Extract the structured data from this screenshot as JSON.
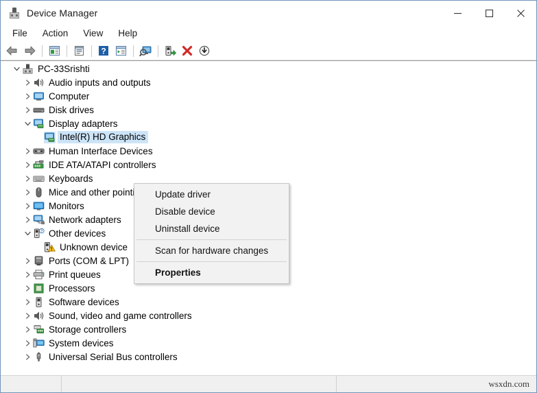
{
  "window": {
    "title": "Device Manager",
    "icon": "device-manager-icon",
    "controls": {
      "minimize": "minimize-icon",
      "maximize": "maximize-icon",
      "close": "close-icon"
    }
  },
  "menubar": {
    "items": [
      {
        "label": "File"
      },
      {
        "label": "Action"
      },
      {
        "label": "View"
      },
      {
        "label": "Help"
      }
    ]
  },
  "toolbar": {
    "buttons": [
      {
        "name": "back-button",
        "icon": "back-arrow-icon"
      },
      {
        "name": "forward-button",
        "icon": "forward-arrow-icon"
      },
      {
        "name": "separator",
        "icon": "separator"
      },
      {
        "name": "show-hide-console-tree-button",
        "icon": "console-tree-icon"
      },
      {
        "name": "separator",
        "icon": "separator"
      },
      {
        "name": "properties-button",
        "icon": "properties-window-icon"
      },
      {
        "name": "separator",
        "icon": "separator"
      },
      {
        "name": "help-button",
        "icon": "help-question-icon"
      },
      {
        "name": "view-button",
        "icon": "view-list-icon"
      },
      {
        "name": "separator",
        "icon": "separator"
      },
      {
        "name": "scan-hardware-changes-button",
        "icon": "scan-monitor-icon"
      },
      {
        "name": "separator",
        "icon": "separator"
      },
      {
        "name": "update-driver-button",
        "icon": "update-driver-icon"
      },
      {
        "name": "uninstall-device-button",
        "icon": "red-x-icon"
      },
      {
        "name": "disable-device-button",
        "icon": "down-arrow-circle-icon"
      }
    ]
  },
  "tree": {
    "nodes": [
      {
        "label": "PC-33Srishti",
        "icon": "computer-root-icon",
        "indent": 0,
        "state": "expanded",
        "selected": false
      },
      {
        "label": "Audio inputs and outputs",
        "icon": "speaker-icon",
        "indent": 1,
        "state": "collapsed",
        "selected": false
      },
      {
        "label": "Computer",
        "icon": "monitor-icon",
        "indent": 1,
        "state": "collapsed",
        "selected": false
      },
      {
        "label": "Disk drives",
        "icon": "disk-drive-icon",
        "indent": 1,
        "state": "collapsed",
        "selected": false
      },
      {
        "label": "Display adapters",
        "icon": "display-adapter-icon",
        "indent": 1,
        "state": "expanded",
        "selected": false
      },
      {
        "label": "Intel(R) HD Graphics",
        "icon": "display-adapter-icon",
        "indent": 2,
        "state": "leaf",
        "selected": true
      },
      {
        "label": "Human Interface Devices",
        "icon": "hid-icon",
        "indent": 1,
        "state": "collapsed",
        "selected": false
      },
      {
        "label": "IDE ATA/ATAPI controllers",
        "icon": "ide-controller-icon",
        "indent": 1,
        "state": "collapsed",
        "selected": false
      },
      {
        "label": "Keyboards",
        "icon": "keyboard-icon",
        "indent": 1,
        "state": "collapsed",
        "selected": false
      },
      {
        "label": "Mice and other pointing devices",
        "icon": "mouse-icon",
        "indent": 1,
        "state": "collapsed",
        "selected": false
      },
      {
        "label": "Monitors",
        "icon": "monitor-icon",
        "indent": 1,
        "state": "collapsed",
        "selected": false
      },
      {
        "label": "Network adapters",
        "icon": "network-adapter-icon",
        "indent": 1,
        "state": "collapsed",
        "selected": false
      },
      {
        "label": "Other devices",
        "icon": "other-device-icon",
        "indent": 1,
        "state": "expanded",
        "selected": false
      },
      {
        "label": "Unknown device",
        "icon": "unknown-device-warning-icon",
        "indent": 2,
        "state": "leaf",
        "selected": false
      },
      {
        "label": "Ports (COM & LPT)",
        "icon": "port-icon",
        "indent": 1,
        "state": "collapsed",
        "selected": false
      },
      {
        "label": "Print queues",
        "icon": "printer-icon",
        "indent": 1,
        "state": "collapsed",
        "selected": false
      },
      {
        "label": "Processors",
        "icon": "processor-icon",
        "indent": 1,
        "state": "collapsed",
        "selected": false
      },
      {
        "label": "Software devices",
        "icon": "software-device-icon",
        "indent": 1,
        "state": "collapsed",
        "selected": false
      },
      {
        "label": "Sound, video and game controllers",
        "icon": "speaker-icon",
        "indent": 1,
        "state": "collapsed",
        "selected": false
      },
      {
        "label": "Storage controllers",
        "icon": "storage-controller-icon",
        "indent": 1,
        "state": "collapsed",
        "selected": false
      },
      {
        "label": "System devices",
        "icon": "system-device-icon",
        "indent": 1,
        "state": "collapsed",
        "selected": false
      },
      {
        "label": "Universal Serial Bus controllers",
        "icon": "usb-controller-icon",
        "indent": 1,
        "state": "collapsed",
        "selected": false
      }
    ]
  },
  "context_menu": {
    "items": [
      {
        "label": "Update driver",
        "type": "item",
        "bold": false
      },
      {
        "label": "Disable device",
        "type": "item",
        "bold": false
      },
      {
        "label": "Uninstall device",
        "type": "item",
        "bold": false
      },
      {
        "label": "",
        "type": "separator",
        "bold": false
      },
      {
        "label": "Scan for hardware changes",
        "type": "item",
        "bold": false
      },
      {
        "label": "",
        "type": "separator",
        "bold": false
      },
      {
        "label": "Properties",
        "type": "item",
        "bold": true
      }
    ]
  },
  "statusbar": {
    "watermark": "wsxdn.com"
  },
  "colors": {
    "selection": "#cce4f7",
    "window_border": "#6f96bc",
    "menu_bg": "#f2f2f2",
    "statusbar_bg": "#f0f0f0",
    "warning": "#ffc20e",
    "error_red": "#d22a2a"
  }
}
